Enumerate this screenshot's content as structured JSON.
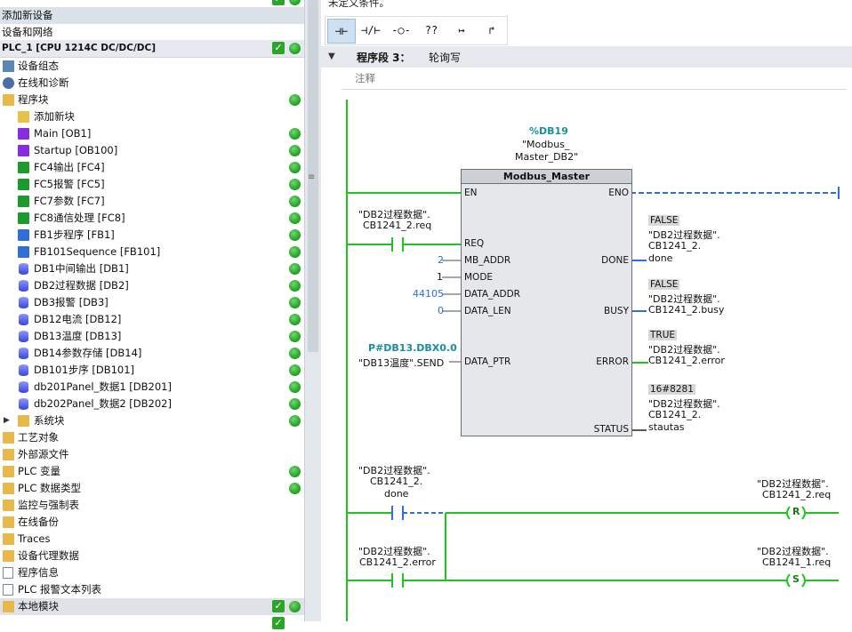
{
  "tree": {
    "items": [
      {
        "label": "添加新设备"
      },
      {
        "label": "设备和网络"
      },
      {
        "label": "PLC_1 [CPU 1214C DC/DC/DC]"
      },
      {
        "label": "设备组态"
      },
      {
        "label": "在线和诊断"
      },
      {
        "label": "程序块"
      },
      {
        "label": "添加新块"
      },
      {
        "label": "Main [OB1]"
      },
      {
        "label": "Startup [OB100]"
      },
      {
        "label": "FC4输出 [FC4]"
      },
      {
        "label": "FC5报警 [FC5]"
      },
      {
        "label": "FC7参数 [FC7]"
      },
      {
        "label": "FC8通信处理 [FC8]"
      },
      {
        "label": "FB1步程序 [FB1]"
      },
      {
        "label": "FB101Sequence [FB101]"
      },
      {
        "label": "DB1中间输出 [DB1]"
      },
      {
        "label": "DB2过程数据 [DB2]"
      },
      {
        "label": "DB3报警 [DB3]"
      },
      {
        "label": "DB12电流 [DB12]"
      },
      {
        "label": "DB13温度 [DB13]"
      },
      {
        "label": "DB14参数存储 [DB14]"
      },
      {
        "label": "DB101步序 [DB101]"
      },
      {
        "label": "db201Panel_数据1 [DB201]"
      },
      {
        "label": "db202Panel_数据2 [DB202]"
      },
      {
        "label": "系统块"
      },
      {
        "label": "工艺对象"
      },
      {
        "label": "外部源文件"
      },
      {
        "label": "PLC 变量"
      },
      {
        "label": "PLC 数据类型"
      },
      {
        "label": "监控与强制表"
      },
      {
        "label": "在线备份"
      },
      {
        "label": "Traces"
      },
      {
        "label": "设备代理数据"
      },
      {
        "label": "程序信息"
      },
      {
        "label": "PLC 报警文本列表"
      },
      {
        "label": "本地模块"
      }
    ]
  },
  "editor": {
    "condition_text": "未定义条件。",
    "segment_label": "程序段 3：",
    "segment_name": "轮询写",
    "comment_placeholder": "注释",
    "toolbar": [
      "⊣⊢",
      "⊣/⊢",
      "-○-",
      "??",
      "↦",
      "↱"
    ]
  },
  "block": {
    "instance_addr": "%DB19",
    "instance_name1": "\"Modbus_",
    "instance_name2": "Master_DB2\"",
    "name": "Modbus_Master",
    "in_pins": [
      "EN",
      "REQ",
      "MB_ADDR",
      "MODE",
      "DATA_ADDR",
      "DATA_LEN",
      "DATA_PTR"
    ],
    "out_pins": [
      "ENO",
      "DONE",
      "BUSY",
      "ERROR",
      "STATUS"
    ],
    "req_tag1": "\"DB2过程数据\".",
    "req_tag2": "CB1241_2.req",
    "mb_addr": "2",
    "mode": "1",
    "data_addr": "44105",
    "data_len": "0",
    "ptr_addr": "P#DB13.DBX0.0",
    "ptr_tag": "\"DB13温度\".SEND",
    "done_val": "FALSE",
    "done_tag1": "\"DB2过程数据\".",
    "done_tag2": "CB1241_2.",
    "done_tag3": "done",
    "busy_val": "FALSE",
    "busy_tag1": "\"DB2过程数据\".",
    "busy_tag2": "CB1241_2.busy",
    "error_val": "TRUE",
    "error_tag1": "\"DB2过程数据\".",
    "error_tag2": "CB1241_2.error",
    "status_val": "16#8281",
    "status_tag1": "\"DB2过程数据\".",
    "status_tag2": "CB1241_2.",
    "status_tag3": "stautas"
  },
  "rung2": {
    "contact_tag1": "\"DB2过程数据\".",
    "contact_tag2": "CB1241_2.",
    "contact_tag3": "done",
    "coil_tag1": "\"DB2过程数据\".",
    "coil_tag2": "CB1241_2.req",
    "coil_type": "R"
  },
  "rung3": {
    "contact_tag1": "\"DB2过程数据\".",
    "contact_tag2": "CB1241_2.error",
    "coil_tag1": "\"DB2过程数据\".",
    "coil_tag2": "CB1241_1.req",
    "coil_type": "S"
  },
  "colors": {
    "energized": "#1fc41f",
    "highlight_blue": "#2f6fd6",
    "teal": "#1a8fa0"
  }
}
